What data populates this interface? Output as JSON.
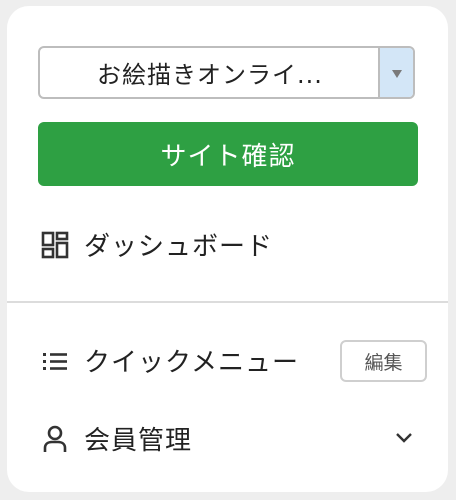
{
  "site_selector": {
    "selected": "お絵描きオンライ..."
  },
  "site_confirm_button": {
    "label": "サイト確認"
  },
  "menu": {
    "dashboard": {
      "label": "ダッシュボード",
      "icon": "dashboard-grid-icon"
    },
    "quick_menu": {
      "label": "クイックメニュー",
      "icon": "list-icon",
      "edit_label": "編集"
    },
    "members": {
      "label": "会員管理",
      "icon": "user-icon",
      "expand_icon": "chevron-down-icon"
    }
  },
  "colors": {
    "accent_green": "#2ea043",
    "select_arrow_bg": "#d3e6f7"
  }
}
